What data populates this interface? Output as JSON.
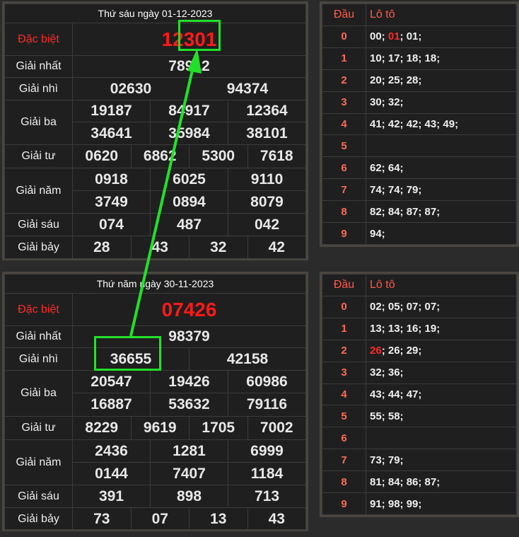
{
  "draw1": {
    "header": "Thứ sáu ngày 01-12-2023",
    "labels": {
      "special": "Đặc biệt",
      "first": "Giải nhất",
      "second": "Giải nhì",
      "third": "Giải ba",
      "fourth": "Giải tư",
      "fifth": "Giải năm",
      "sixth": "Giải sáu",
      "seventh": "Giải bảy"
    },
    "special": "12301",
    "first": "78912",
    "second": [
      "02630",
      "94374"
    ],
    "third": [
      "19187",
      "84917",
      "12364",
      "34641",
      "35984",
      "38101"
    ],
    "fourth": [
      "0620",
      "6862",
      "5300",
      "7618"
    ],
    "fifth": [
      "0918",
      "6025",
      "9110",
      "3749",
      "0894",
      "8079"
    ],
    "sixth": [
      "074",
      "487",
      "042"
    ],
    "seventh": [
      "28",
      "43",
      "32",
      "42"
    ]
  },
  "loto1": {
    "col_head": "Đầu",
    "col_loto": "Lô tô",
    "rows": [
      {
        "d": "0",
        "pre": "00; ",
        "hl": "01",
        "post": "; 01;"
      },
      {
        "d": "1",
        "pre": "10; 17; 18; 18;",
        "hl": "",
        "post": ""
      },
      {
        "d": "2",
        "pre": "20; 25; 28;",
        "hl": "",
        "post": ""
      },
      {
        "d": "3",
        "pre": "30; 32;",
        "hl": "",
        "post": ""
      },
      {
        "d": "4",
        "pre": "41; 42; 42; 43; 49;",
        "hl": "",
        "post": ""
      },
      {
        "d": "5",
        "pre": "",
        "hl": "",
        "post": ""
      },
      {
        "d": "6",
        "pre": "62; 64;",
        "hl": "",
        "post": ""
      },
      {
        "d": "7",
        "pre": "74; 74; 79;",
        "hl": "",
        "post": ""
      },
      {
        "d": "8",
        "pre": "82; 84; 87; 87;",
        "hl": "",
        "post": ""
      },
      {
        "d": "9",
        "pre": "94;",
        "hl": "",
        "post": ""
      }
    ]
  },
  "draw2": {
    "header": "Thứ năm ngày 30-11-2023",
    "labels": {
      "special": "Đặc biệt",
      "first": "Giải nhất",
      "second": "Giải nhì",
      "third": "Giải ba",
      "fourth": "Giải tư",
      "fifth": "Giải năm",
      "sixth": "Giải sáu",
      "seventh": "Giải bảy"
    },
    "special": "07426",
    "first": "98379",
    "second": [
      "36655",
      "42158"
    ],
    "third": [
      "20547",
      "19426",
      "60986",
      "16887",
      "53632",
      "79116"
    ],
    "fourth": [
      "8229",
      "9619",
      "1705",
      "7002"
    ],
    "fifth": [
      "2436",
      "1281",
      "6999",
      "0144",
      "7407",
      "1184"
    ],
    "sixth": [
      "391",
      "898",
      "713"
    ],
    "seventh": [
      "73",
      "07",
      "13",
      "43"
    ]
  },
  "loto2": {
    "col_head": "Đầu",
    "col_loto": "Lô tô",
    "rows": [
      {
        "d": "0",
        "pre": "02; 05; 07; 07;",
        "hl": "",
        "post": ""
      },
      {
        "d": "1",
        "pre": "13; 13; 16; 19;",
        "hl": "",
        "post": ""
      },
      {
        "d": "2",
        "pre": "",
        "hl": "26",
        "post": "; 26; 29;"
      },
      {
        "d": "3",
        "pre": "32; 36;",
        "hl": "",
        "post": ""
      },
      {
        "d": "4",
        "pre": "43; 44; 47;",
        "hl": "",
        "post": ""
      },
      {
        "d": "5",
        "pre": "55; 58;",
        "hl": "",
        "post": ""
      },
      {
        "d": "6",
        "pre": "",
        "hl": "",
        "post": ""
      },
      {
        "d": "7",
        "pre": "73; 79;",
        "hl": "",
        "post": ""
      },
      {
        "d": "8",
        "pre": "81; 84; 86; 87;",
        "hl": "",
        "post": ""
      },
      {
        "d": "9",
        "pre": "91; 98; 99;",
        "hl": "",
        "post": ""
      }
    ]
  },
  "colors": {
    "highlight": "#22e02a",
    "special": "#ff1a1a",
    "digit": "#ff6a5a"
  }
}
